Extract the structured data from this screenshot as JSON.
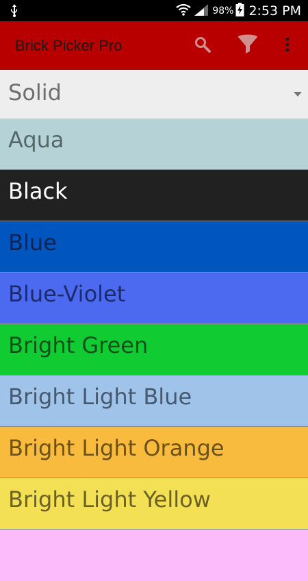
{
  "status_bar": {
    "battery_percent": "98%",
    "time": "2:53 PM",
    "icons": [
      "usb-icon",
      "wifi-icon",
      "signal-icon",
      "battery-charging-icon"
    ]
  },
  "app_bar": {
    "title": "Brick Picker Pro",
    "actions": [
      "search-icon",
      "filter-icon",
      "overflow-menu-icon"
    ],
    "background": "#b80000"
  },
  "spinner": {
    "selected": "Solid"
  },
  "colors": [
    {
      "name": "Aqua",
      "bg": "#b5d3d6",
      "fg": "#56676a"
    },
    {
      "name": "Black",
      "bg": "#212121",
      "fg": "#ffffff"
    },
    {
      "name": "Blue",
      "bg": "#0055bf",
      "fg": "#0f2450"
    },
    {
      "name": "Blue-Violet",
      "bg": "#4c6aef",
      "fg": "#1d2b6b"
    },
    {
      "name": "Bright Green",
      "bg": "#10cb31",
      "fg": "#14501d"
    },
    {
      "name": "Bright Light Blue",
      "bg": "#9fc3e9",
      "fg": "#46596e"
    },
    {
      "name": "Bright Light Orange",
      "bg": "#f8bb3d",
      "fg": "#6c5119"
    },
    {
      "name": "Bright Light Yellow",
      "bg": "#f3e055",
      "fg": "#6b6124"
    },
    {
      "name": "",
      "bg": "#fcbcfc",
      "fg": "#6b506b"
    }
  ]
}
